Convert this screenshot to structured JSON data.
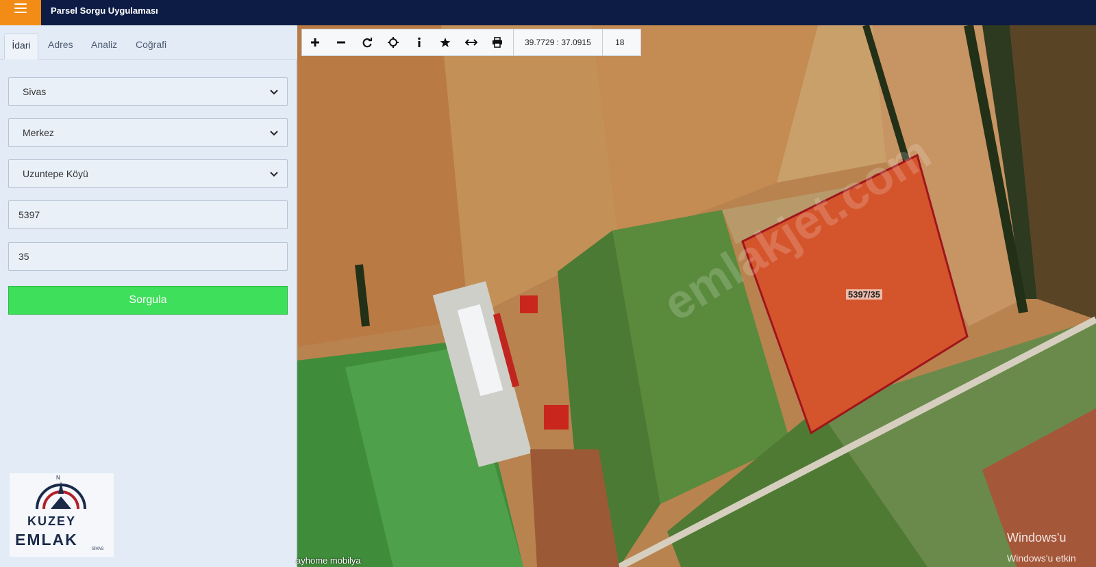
{
  "header": {
    "subtitle": "Parsel Sorgu Uygulaması"
  },
  "tabs": [
    "İdari",
    "Adres",
    "Analiz",
    "Coğrafi"
  ],
  "form": {
    "il": "Sivas",
    "ilce": "Merkez",
    "mahalle": "Uzuntepe Köyü",
    "ada": "5397",
    "parsel": "35",
    "query_button": "Sorgula"
  },
  "logo": {
    "north": "N",
    "line1": "KUZEY",
    "line2": "EMLAK",
    "line3": "SİVAS"
  },
  "toolbar": {
    "coordinates": "39.7729 : 37.0915",
    "zoom": "18",
    "icons": [
      "plus-icon",
      "minus-icon",
      "refresh-icon",
      "crosshair-icon",
      "info-icon",
      "star-icon",
      "measure-icon",
      "print-icon"
    ]
  },
  "map": {
    "parcel_label": "5397/35",
    "place_label": "ayhome mobilya",
    "watermark_text": "emlakjet.com",
    "os_watermark_1": "Windows'u",
    "os_watermark_2": "Windows'u etkin"
  },
  "colors": {
    "header": "#0d1c45",
    "menu": "#f28c16",
    "query_button": "#3edf5a",
    "parcel_outline": "#a0141c"
  }
}
